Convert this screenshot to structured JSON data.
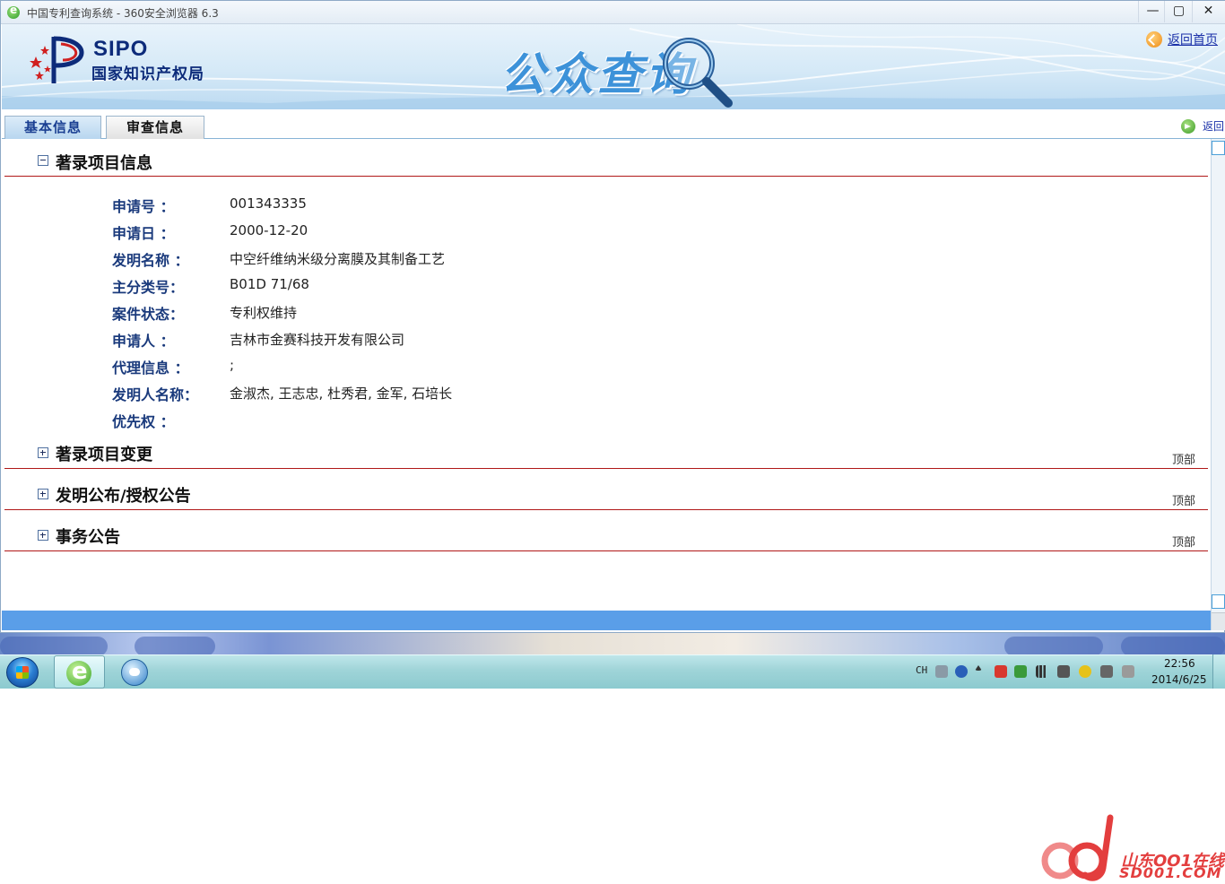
{
  "window": {
    "title": "中国专利查询系统 - 360安全浏览器 6.3",
    "min_symbol": "—",
    "max_symbol": "▢",
    "close_symbol": "✕"
  },
  "banner": {
    "logo_text": "SIPO",
    "logo_subtitle": "国家知识产权局",
    "title": "公众查询",
    "home_link": "返回首页"
  },
  "tabs": [
    {
      "label": "基本信息",
      "active": true
    },
    {
      "label": "审查信息",
      "active": false
    }
  ],
  "back_link": "返回",
  "sections": [
    {
      "title": "著录项目信息",
      "expanded": true,
      "top_link": ""
    },
    {
      "title": "著录项目变更",
      "expanded": false,
      "top_link": "顶部"
    },
    {
      "title": "发明公布/授权公告",
      "expanded": false,
      "top_link": "顶部"
    },
    {
      "title": "事务公告",
      "expanded": false,
      "top_link": "顶部"
    }
  ],
  "fields": [
    {
      "label": "申请号 ：",
      "value": "001343335"
    },
    {
      "label": "申请日 ：",
      "value": "2000-12-20"
    },
    {
      "label": "发明名称 ：",
      "value": "中空纤维纳米级分离膜及其制备工艺"
    },
    {
      "label": "主分类号：",
      "value": "B01D 71/68"
    },
    {
      "label": "案件状态：",
      "value": "专利权维持"
    },
    {
      "label": "申请人 ：",
      "value": "吉林市金赛科技开发有限公司"
    },
    {
      "label": "代理信息 ：",
      "value": ";"
    },
    {
      "label": "发明人名称：",
      "value": "金淑杰, 王志忠, 杜秀君, 金军, 石培长"
    },
    {
      "label": "优先权 ：",
      "value": ""
    }
  ],
  "taskbar": {
    "lang": "CH",
    "time": "22:56",
    "date": "2014/6/25"
  },
  "watermark": {
    "line1": "山东OO1在线",
    "line2": "SD001.COM"
  },
  "colors": {
    "accent_blue": "#5a9ee8",
    "section_rule": "#b01818",
    "label_blue": "#1a3a7c",
    "watermark_red": "#e33e3e"
  }
}
